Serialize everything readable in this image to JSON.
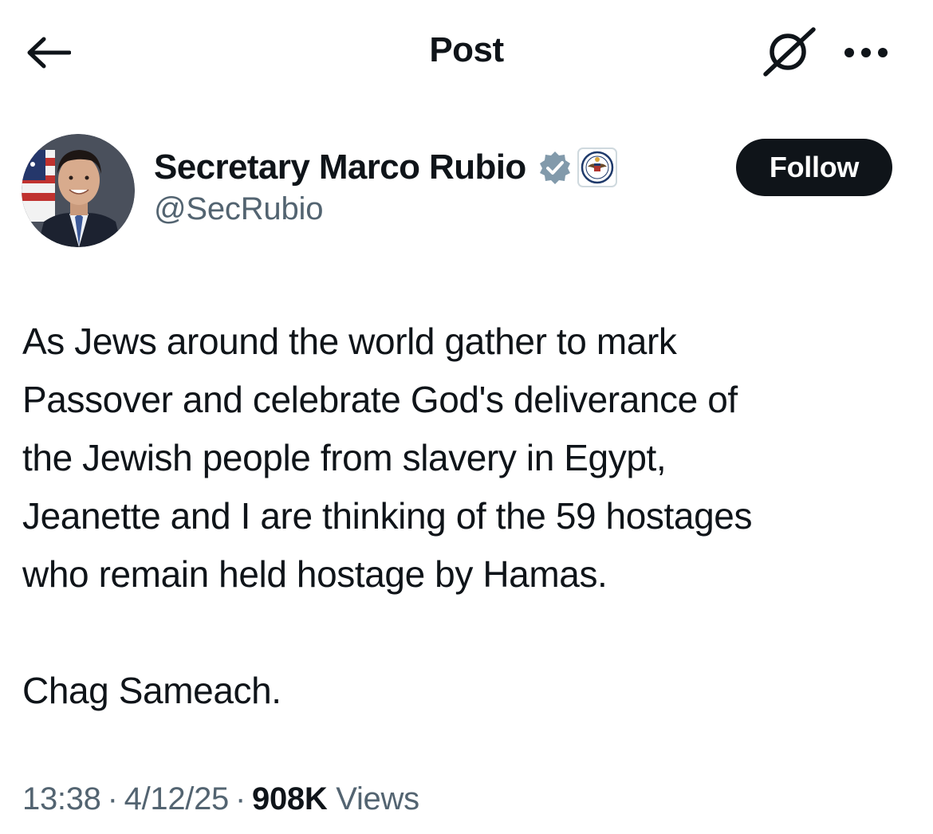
{
  "header": {
    "title": "Post",
    "icons": {
      "back": "arrow-left-icon",
      "grok": "grok-icon",
      "more": "more-horizontal-icon"
    }
  },
  "author": {
    "display_name": "Secretary Marco Rubio",
    "handle": "@SecRubio",
    "verified_badge": "verified-badge-icon",
    "verified_color": "#829aab",
    "affiliate_badge": "state-department-seal-icon",
    "avatar": "avatar"
  },
  "follow_button": {
    "label": "Follow",
    "background": "#0f1419",
    "text_color": "#ffffff"
  },
  "post": {
    "line1": "As Jews around the world gather to mark",
    "line2": "Passover and celebrate God's deliverance of",
    "line3": "the Jewish people from slavery in Egypt,",
    "line4": "Jeanette and I are thinking of the 59 hostages",
    "line5": "who remain held hostage by Hamas.",
    "line6": "Chag Sameach."
  },
  "meta": {
    "time": "13:38",
    "separator": "·",
    "date": "4/12/25",
    "views_count": "908K",
    "views_label": "Views"
  }
}
